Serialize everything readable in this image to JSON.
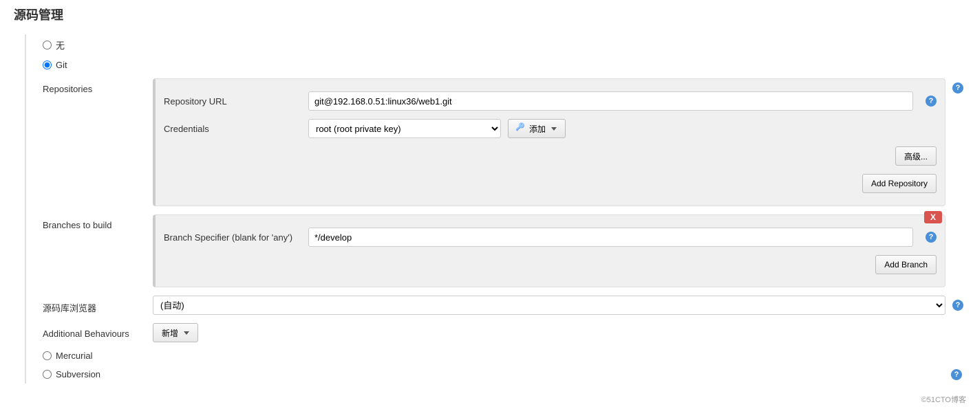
{
  "section": {
    "title": "源码管理"
  },
  "scm": {
    "options": {
      "none": "无",
      "git": "Git",
      "mercurial": "Mercurial",
      "subversion": "Subversion"
    },
    "selected": "git"
  },
  "git": {
    "repositories": {
      "label": "Repositories",
      "repo_url_label": "Repository URL",
      "repo_url_value": "git@192.168.0.51:linux36/web1.git",
      "credentials_label": "Credentials",
      "credentials_value": "root (root private key)",
      "add_credentials_label": "添加",
      "advanced_label": "高级...",
      "add_repo_label": "Add Repository"
    },
    "branches": {
      "label": "Branches to build",
      "specifier_label": "Branch Specifier (blank for 'any')",
      "specifier_value": "*/develop",
      "add_branch_label": "Add Branch",
      "delete_label": "X"
    },
    "browser": {
      "label": "源码库浏览器",
      "value": "(自动)"
    },
    "additional": {
      "label": "Additional Behaviours",
      "add_label": "新增"
    }
  },
  "watermark": "©51CTO博客"
}
